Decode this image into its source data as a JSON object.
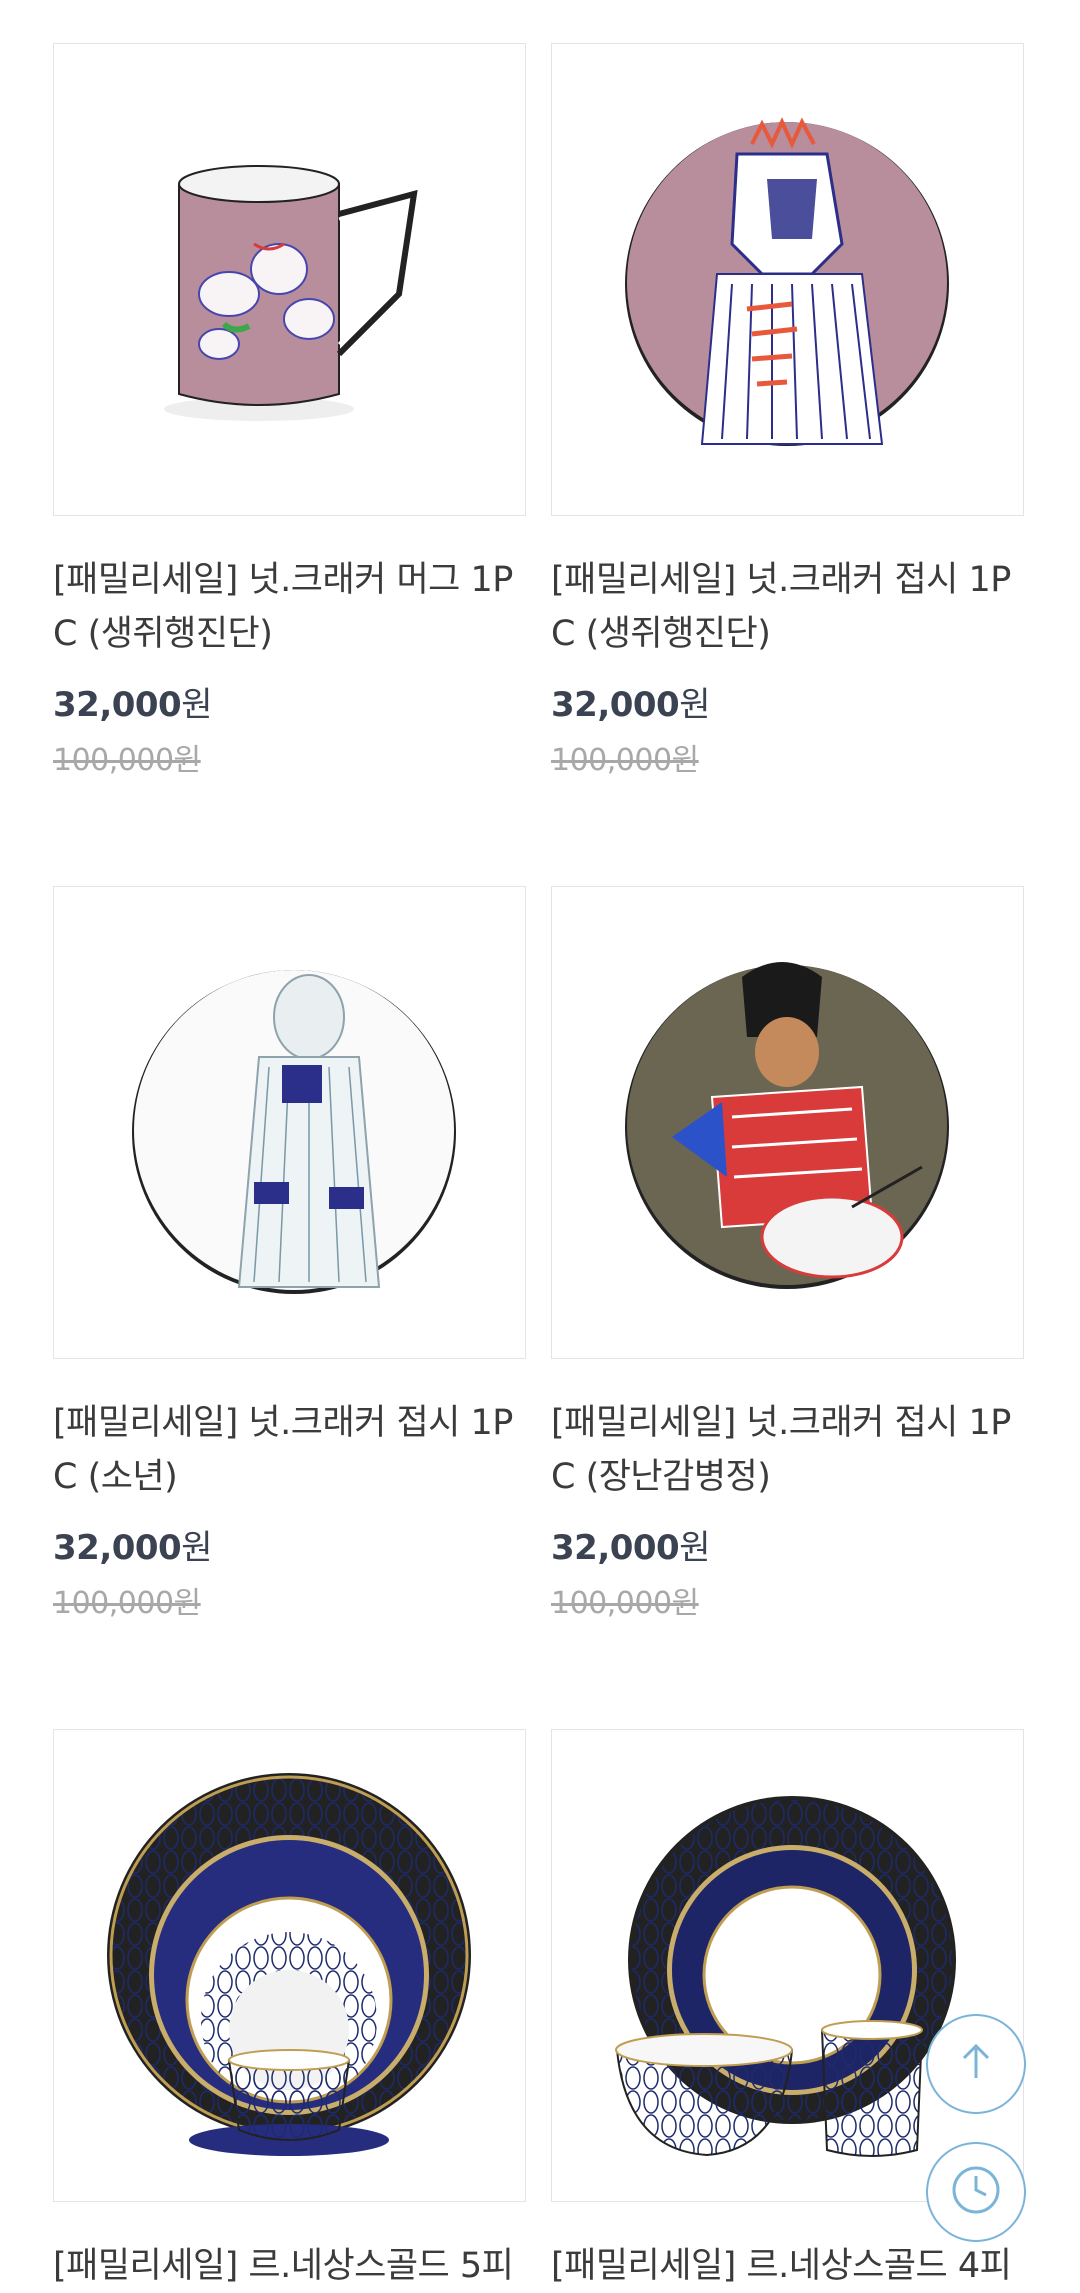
{
  "currency": "원",
  "products": [
    {
      "title": "[패밀리세일] 넛.크래커 머그 1PC (생쥐행진단)",
      "price": "32,000",
      "original_price": "100,000원",
      "image": "mug-mice-image"
    },
    {
      "title": "[패밀리세일] 넛.크래커 접시 1PC (생쥐행진단)",
      "price": "32,000",
      "original_price": "100,000원",
      "image": "plate-mouse-image"
    },
    {
      "title": "[패밀리세일] 넛.크래커 접시 1PC (소년)",
      "price": "32,000",
      "original_price": "100,000원",
      "image": "plate-boy-image"
    },
    {
      "title": "[패밀리세일] 넛.크래커 접시 1PC (장난감병정)",
      "price": "32,000",
      "original_price": "100,000원",
      "image": "plate-soldier-image"
    },
    {
      "title": "[패밀리세일] 르.네상스골드 5피",
      "price": "",
      "original_price": "",
      "image": "renaissance-5pc-image"
    },
    {
      "title": "[패밀리세일] 르.네상스골드 4피",
      "price": "",
      "original_price": "",
      "image": "renaissance-4pc-image"
    }
  ],
  "colors": {
    "accent_ring": "#7ab5d8",
    "navy": "#2b2f8a",
    "mauve": "#b88d9c"
  }
}
